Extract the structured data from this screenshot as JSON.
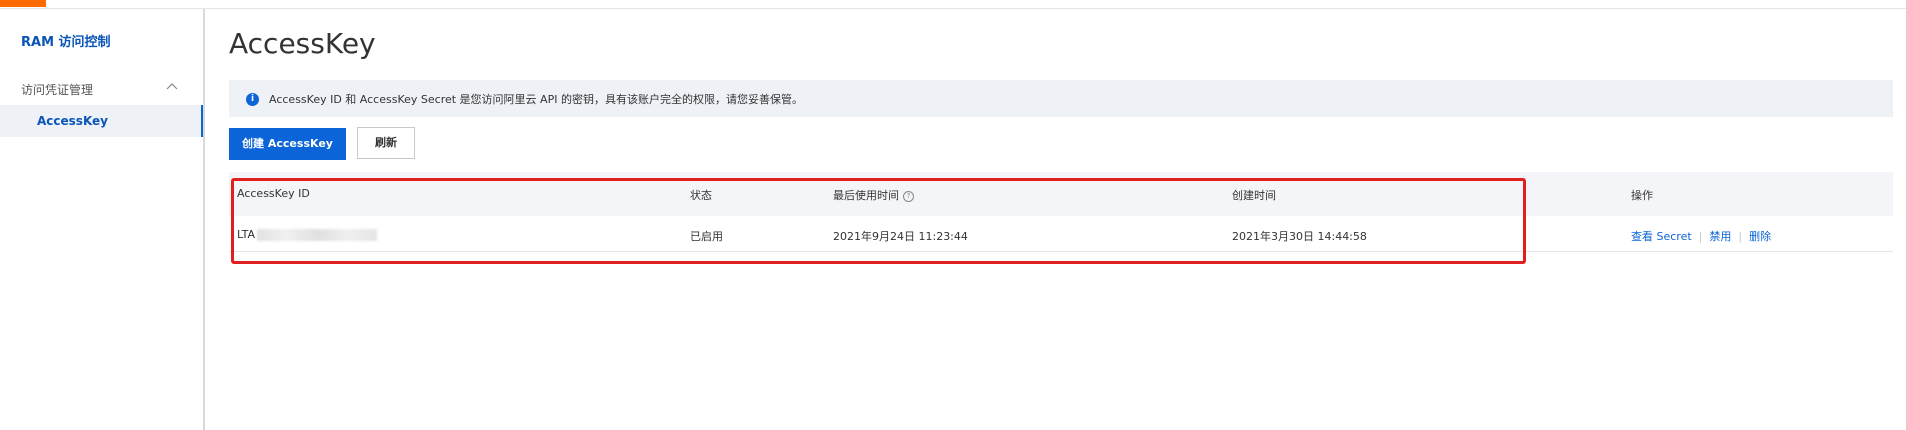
{
  "topbar": {
    "accent_color": "#ff6a00"
  },
  "sidebar": {
    "brand": "RAM 访问控制",
    "group": {
      "label": "访问凭证管理",
      "icon": "chevron-up-icon"
    },
    "items": [
      {
        "label": "AccessKey",
        "active": true
      }
    ]
  },
  "main": {
    "title": "AccessKey",
    "notice": {
      "icon": "info-icon",
      "text": "AccessKey ID 和 AccessKey Secret 是您访问阿里云 API 的密钥，具有该账户完全的权限，请您妥善保管。"
    },
    "buttons": {
      "create": "创建 AccessKey",
      "refresh": "刷新"
    },
    "table": {
      "columns": [
        "AccessKey ID",
        "状态",
        "最后使用时间",
        "创建时间",
        "操作"
      ],
      "rows": [
        {
          "access_key_id": "LTA",
          "status": "已启用",
          "last_used": "2021年9月24日 11:23:44",
          "created": "2021年3月30日 14:44:58",
          "actions": [
            "查看 Secret",
            "禁用",
            "删除"
          ]
        }
      ]
    }
  },
  "colors": {
    "primary": "#0b64d8",
    "highlight_border": "#e02020",
    "notice_bg": "#eef1f6"
  }
}
